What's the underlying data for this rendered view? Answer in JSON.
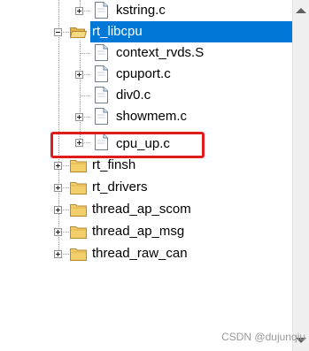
{
  "tree": {
    "items": [
      {
        "label": "kstring.c",
        "type": "file",
        "expander": "plus"
      },
      {
        "label": "rt_libcpu",
        "type": "folder-open",
        "expander": "minus",
        "selected": true
      },
      {
        "label": "context_rvds.S",
        "type": "file",
        "expander": "none"
      },
      {
        "label": "cpuport.c",
        "type": "file",
        "expander": "plus"
      },
      {
        "label": "div0.c",
        "type": "file",
        "expander": "none"
      },
      {
        "label": "showmem.c",
        "type": "file",
        "expander": "plus"
      },
      {
        "label": "cpu_up.c",
        "type": "file",
        "expander": "plus",
        "highlighted": true
      },
      {
        "label": "rt_finsh",
        "type": "folder",
        "expander": "plus"
      },
      {
        "label": "rt_drivers",
        "type": "folder",
        "expander": "plus"
      },
      {
        "label": "thread_ap_scom",
        "type": "folder",
        "expander": "plus"
      },
      {
        "label": "thread_ap_msg",
        "type": "folder",
        "expander": "plus"
      },
      {
        "label": "thread_raw_can",
        "type": "folder",
        "expander": "plus"
      }
    ]
  },
  "colors": {
    "selection": "#0078d7",
    "highlight_box": "#e01b1b",
    "folder": "#e8c25a"
  },
  "watermark": {
    "text": "CSDN @dujunqiu"
  }
}
